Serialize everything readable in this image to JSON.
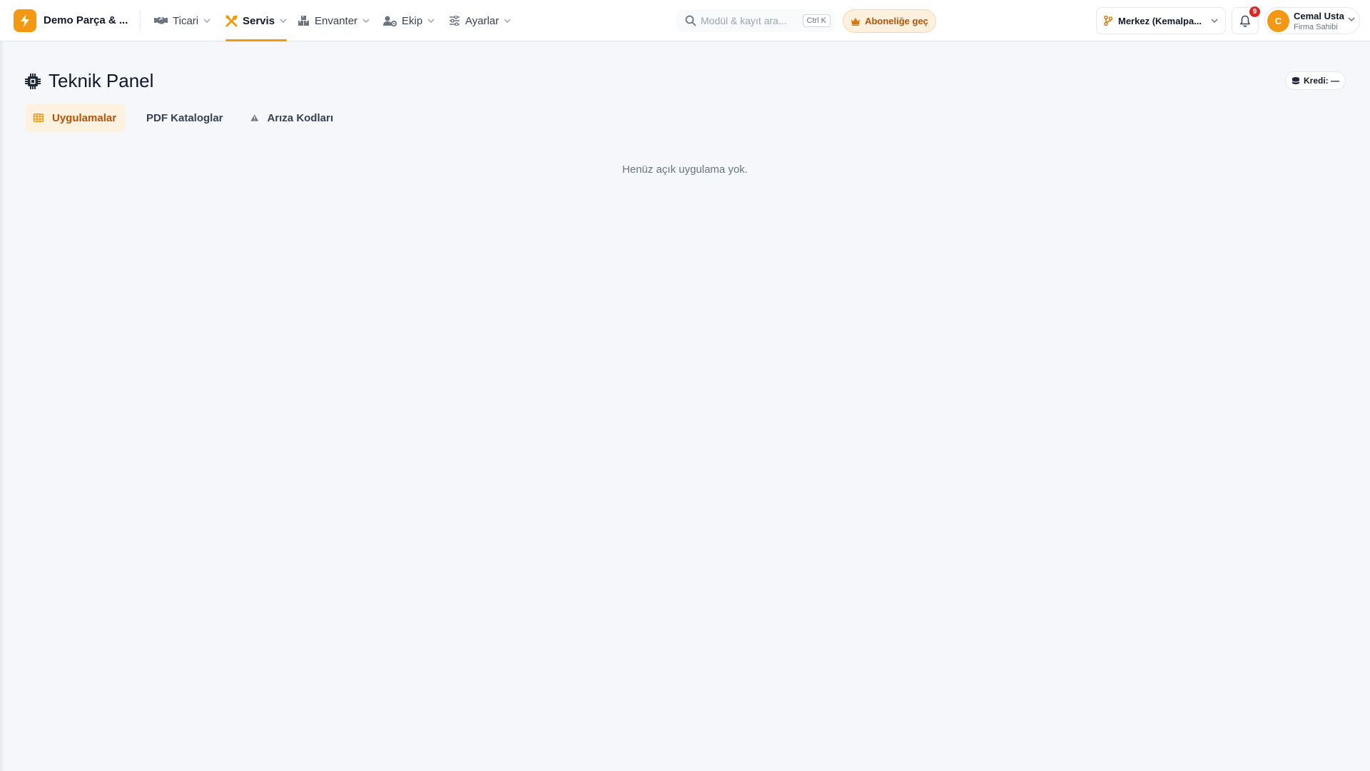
{
  "brand": {
    "name": "Demo Parça & ..."
  },
  "nav": {
    "items": [
      {
        "label": "Ticari",
        "icon": "handshake-icon"
      },
      {
        "label": "Servis",
        "icon": "tools-icon",
        "active": true
      },
      {
        "label": "Envanter",
        "icon": "boxes-icon"
      },
      {
        "label": "Ekip",
        "icon": "users-gear-icon"
      },
      {
        "label": "Ayarlar",
        "icon": "sliders-icon"
      }
    ]
  },
  "search": {
    "placeholder": "Modül & kayıt ara...",
    "shortcut": "Ctrl K"
  },
  "upgrade": {
    "label": "Aboneliğe geç"
  },
  "branch": {
    "label": "Merkez (Kemalpa..."
  },
  "notifications": {
    "count": "9"
  },
  "user": {
    "initial": "C",
    "name": "Cemal Usta",
    "role": "Firma Sahibi"
  },
  "page": {
    "title": "Teknik Panel",
    "credit_label": "Kredi: —",
    "tabs": [
      {
        "label": "Uygulamalar",
        "icon": "table-icon",
        "active": true
      },
      {
        "label": "PDF Kataloglar",
        "icon": "pdf-file-icon"
      },
      {
        "label": "Arıza Kodları",
        "icon": "warning-icon"
      }
    ],
    "empty_message": "Henüz açık uygulama yok."
  },
  "colors": {
    "accent": "#f29813",
    "accent_text": "#b45309",
    "accent_bg": "#fdf1e0",
    "background": "#f5f7fb"
  }
}
